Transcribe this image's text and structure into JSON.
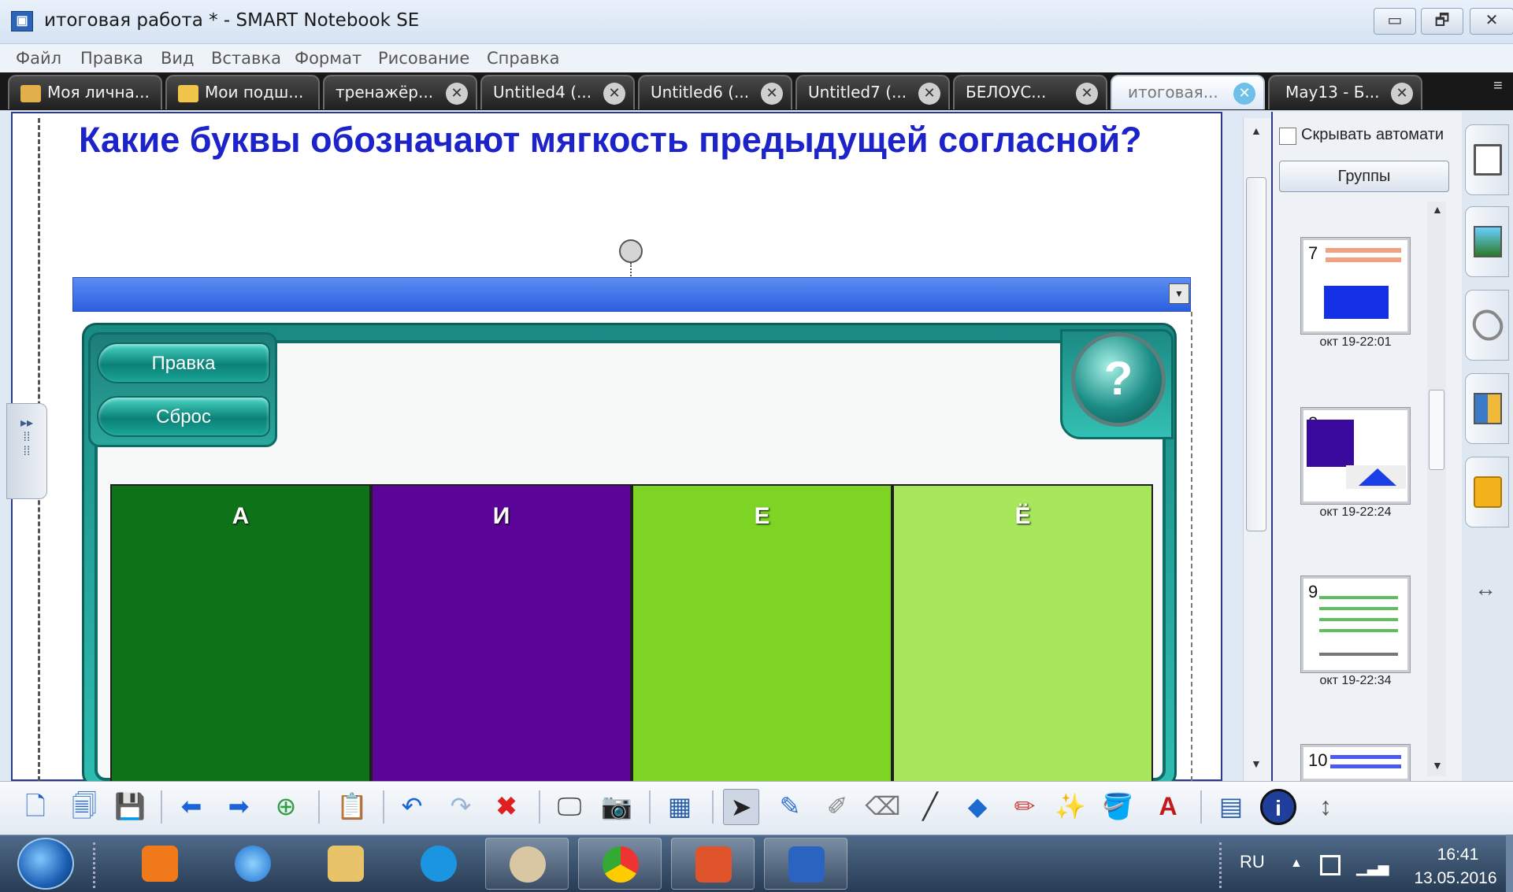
{
  "window": {
    "title": "итоговая работа * - SMART Notebook SE",
    "minimize": "▭",
    "restore": "🗗",
    "close": "✕",
    "app_icon": "▣"
  },
  "menu": [
    "Файл",
    "Правка",
    "Вид",
    "Вставка",
    "Формат",
    "Рисование",
    "Справка"
  ],
  "tabs": [
    {
      "label": "Моя лична...",
      "icon": "home-icon"
    },
    {
      "label": "Мои подш...",
      "icon": "folder-icon"
    },
    {
      "label": "тренажёр...",
      "close": "✕"
    },
    {
      "label": "Untitled4 (...",
      "close": "✕"
    },
    {
      "label": "Untitled6 (...",
      "close": "✕"
    },
    {
      "label": "Untitled7 (...",
      "close": "✕"
    },
    {
      "label": "БЕЛОУС...",
      "close": "✕"
    },
    {
      "label": "итоговая...",
      "close": "✕",
      "active": true
    },
    {
      "label": "May13 - Б...",
      "close": "✕"
    }
  ],
  "page": {
    "question": "Какие буквы обозначают мягкость предыдущей согласной?"
  },
  "activity": {
    "edit_label": "Правка",
    "reset_label": "Сброс",
    "help_label": "?",
    "columns": [
      {
        "label": "А",
        "color": "#0e7218"
      },
      {
        "label": "И",
        "color": "#5b0598"
      },
      {
        "label": "Е",
        "color": "#7dd424"
      },
      {
        "label": "Ё",
        "color": "#a8e65c"
      }
    ]
  },
  "sorter": {
    "autohide_label": "Скрывать автомати",
    "groups_label": "Группы",
    "thumbs": [
      {
        "num": "7",
        "time": "окт 19-22:01"
      },
      {
        "num": "8",
        "time": "окт 19-22:24"
      },
      {
        "num": "9",
        "time": "окт 19-22:34"
      },
      {
        "num": "10",
        "time": ""
      }
    ]
  },
  "toolbar": {
    "icons": [
      "new-page-icon",
      "duplicate-icon",
      "save-icon",
      "back-icon",
      "forward-icon",
      "add-page-icon",
      "paste-icon",
      "undo-icon",
      "redo-icon",
      "delete-icon",
      "show-screen-icon",
      "capture-icon",
      "table-icon",
      "select-icon",
      "pen-icon",
      "creative-pen-icon",
      "eraser-icon",
      "line-icon",
      "shapes-icon",
      "magic-pen-icon",
      "fill-icon",
      "text-icon",
      "properties-icon",
      "info-icon",
      "move-toolbar-icon"
    ]
  },
  "taskbar": {
    "lang": "RU",
    "time": "16:41",
    "date": "13.05.2016"
  }
}
